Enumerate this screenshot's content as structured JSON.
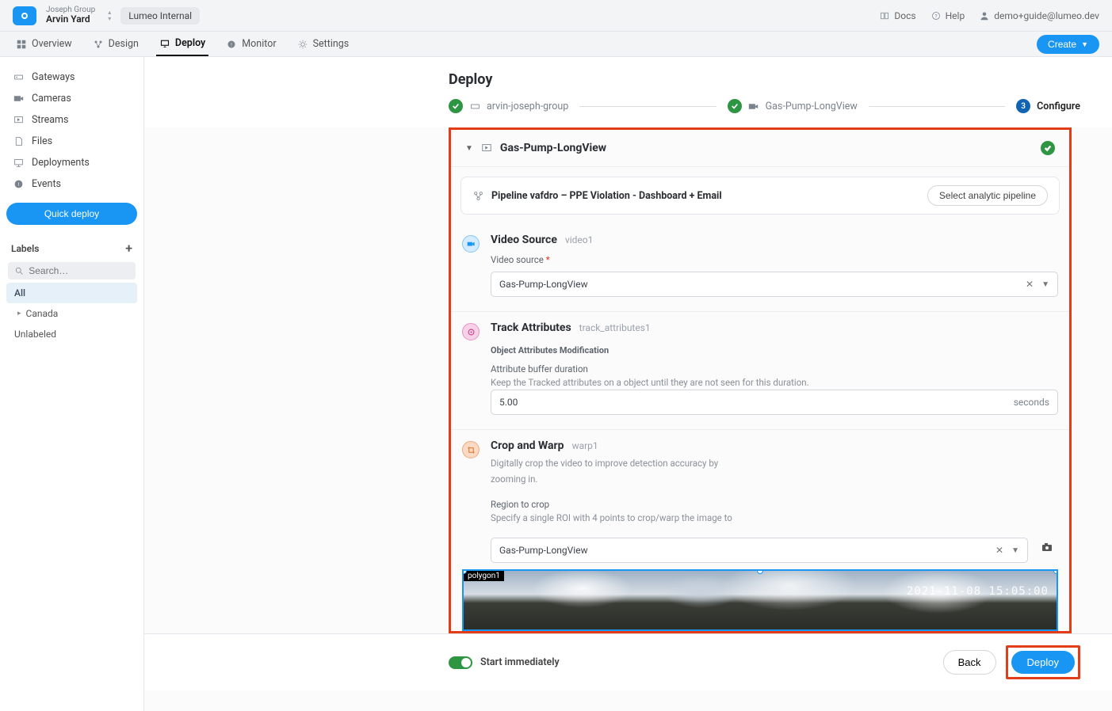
{
  "topbar": {
    "org": "Joseph Group",
    "workspace": "Arvin Yard",
    "env_chip": "Lumeo Internal",
    "docs": "Docs",
    "help": "Help",
    "user_email": "demo+guide@lumeo.dev"
  },
  "nav": {
    "items": [
      {
        "icon": "grid",
        "label": "Overview"
      },
      {
        "icon": "design",
        "label": "Design"
      },
      {
        "icon": "deploy",
        "label": "Deploy"
      },
      {
        "icon": "monitor",
        "label": "Monitor"
      },
      {
        "icon": "settings",
        "label": "Settings"
      }
    ],
    "create": "Create"
  },
  "sidebar": {
    "items": [
      {
        "icon": "gateway",
        "label": "Gateways"
      },
      {
        "icon": "camera",
        "label": "Cameras"
      },
      {
        "icon": "stream",
        "label": "Streams"
      },
      {
        "icon": "file",
        "label": "Files"
      },
      {
        "icon": "deploy",
        "label": "Deployments"
      },
      {
        "icon": "events",
        "label": "Events"
      }
    ],
    "quick_deploy": "Quick deploy",
    "labels_header": "Labels",
    "search_placeholder": "Search…",
    "label_all": "All",
    "label_canada": "Canada",
    "label_unlabeled": "Unlabeled"
  },
  "page": {
    "title": "Deploy"
  },
  "stepper": {
    "step1": "arvin-joseph-group",
    "step2": "Gas-Pump-LongView",
    "step3_num": "3",
    "step3_label": "Configure"
  },
  "panel": {
    "title": "Gas-Pump-LongView",
    "pipeline": {
      "name": "Pipeline vafdro – PPE Violation - Dashboard + Email",
      "select_btn": "Select analytic pipeline"
    },
    "video_source": {
      "title": "Video Source",
      "node_id": "video1",
      "label": "Video source",
      "value": "Gas-Pump-LongView"
    },
    "track_attrs": {
      "title": "Track Attributes",
      "node_id": "track_attributes1",
      "subheader": "Object Attributes Modification",
      "field_label": "Attribute buffer duration",
      "helper": "Keep the Tracked attributes on a object until they are not seen for this duration.",
      "value": "5.00",
      "suffix": "seconds"
    },
    "crop_warp": {
      "title": "Crop and Warp",
      "node_id": "warp1",
      "desc1": "Digitally crop the video to improve detection accuracy by",
      "desc2": "zooming in.",
      "field_label": "Region to crop",
      "helper": "Specify a single ROI with 4 points to crop/warp the image to",
      "value": "Gas-Pump-LongView",
      "polygon_tag": "polygon1",
      "timestamp_overlay": "2021-11-08 15:05:00"
    }
  },
  "footer": {
    "start_immediately": "Start immediately",
    "back": "Back",
    "deploy": "Deploy"
  }
}
